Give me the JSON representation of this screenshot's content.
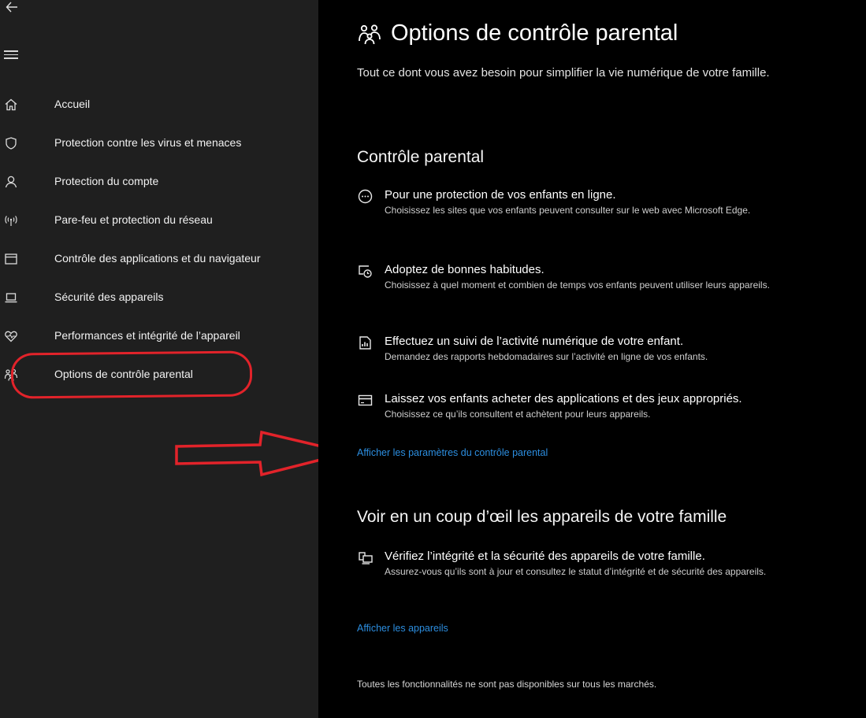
{
  "sidebar": {
    "back_icon": "arrow-left-icon",
    "menu_icon": "hamburger-icon",
    "items": [
      {
        "label": "Accueil",
        "icon": "home-icon"
      },
      {
        "label": "Protection contre les virus et menaces",
        "icon": "shield-icon"
      },
      {
        "label": "Protection du compte",
        "icon": "person-icon"
      },
      {
        "label": "Pare-feu et protection du réseau",
        "icon": "wifi-signal-icon"
      },
      {
        "label": "Contrôle des applications et du navigateur",
        "icon": "app-window-icon"
      },
      {
        "label": "Sécurité des appareils",
        "icon": "laptop-icon"
      },
      {
        "label": "Performances et intégrité de l’appareil",
        "icon": "heart-pulse-icon"
      },
      {
        "label": "Options de contrôle parental",
        "icon": "family-icon"
      }
    ]
  },
  "annotations": {
    "highlight_color": "#e2232a"
  },
  "main": {
    "title": "Options de contrôle parental",
    "subtitle": "Tout ce dont vous avez besoin pour simplifier la vie numérique de votre famille.",
    "parental_section": {
      "title": "Contrôle parental",
      "features": [
        {
          "icon": "globe-dots-icon",
          "title": "Pour une protection de vos enfants en ligne.",
          "desc": "Choisissez les sites que vos enfants peuvent consulter sur le web avec Microsoft Edge."
        },
        {
          "icon": "screen-timer-icon",
          "title": "Adoptez de bonnes habitudes.",
          "desc": "Choisissez à quel moment et combien de temps vos enfants peuvent utiliser leurs appareils."
        },
        {
          "icon": "report-icon",
          "title": "Effectuez un suivi de l’activité numérique de votre enfant.",
          "desc": "Demandez des rapports hebdomadaires sur l’activité en ligne de vos enfants."
        },
        {
          "icon": "card-icon",
          "title": "Laissez vos enfants acheter des applications et des jeux appropriés.",
          "desc": "Choisissez ce qu’ils consultent et achètent pour leurs appareils."
        }
      ],
      "link": "Afficher les paramètres du contrôle parental"
    },
    "devices_section": {
      "title": "Voir en un coup d’œil les appareils de votre famille",
      "feature": {
        "icon": "devices-icon",
        "title": "Vérifiez l’intégrité et la sécurité des appareils de votre famille.",
        "desc": "Assurez-vous qu’ils sont à jour et consultez le statut d’intégrité et de sécurité des appareils."
      },
      "link": "Afficher les appareils"
    },
    "footer_note": "Toutes les fonctionnalités ne sont pas disponibles sur tous les marchés."
  },
  "colors": {
    "sidebar_bg": "#1f1f1f",
    "main_bg": "#000000",
    "link": "#2c8ee0",
    "annotation_red": "#e2232a"
  }
}
